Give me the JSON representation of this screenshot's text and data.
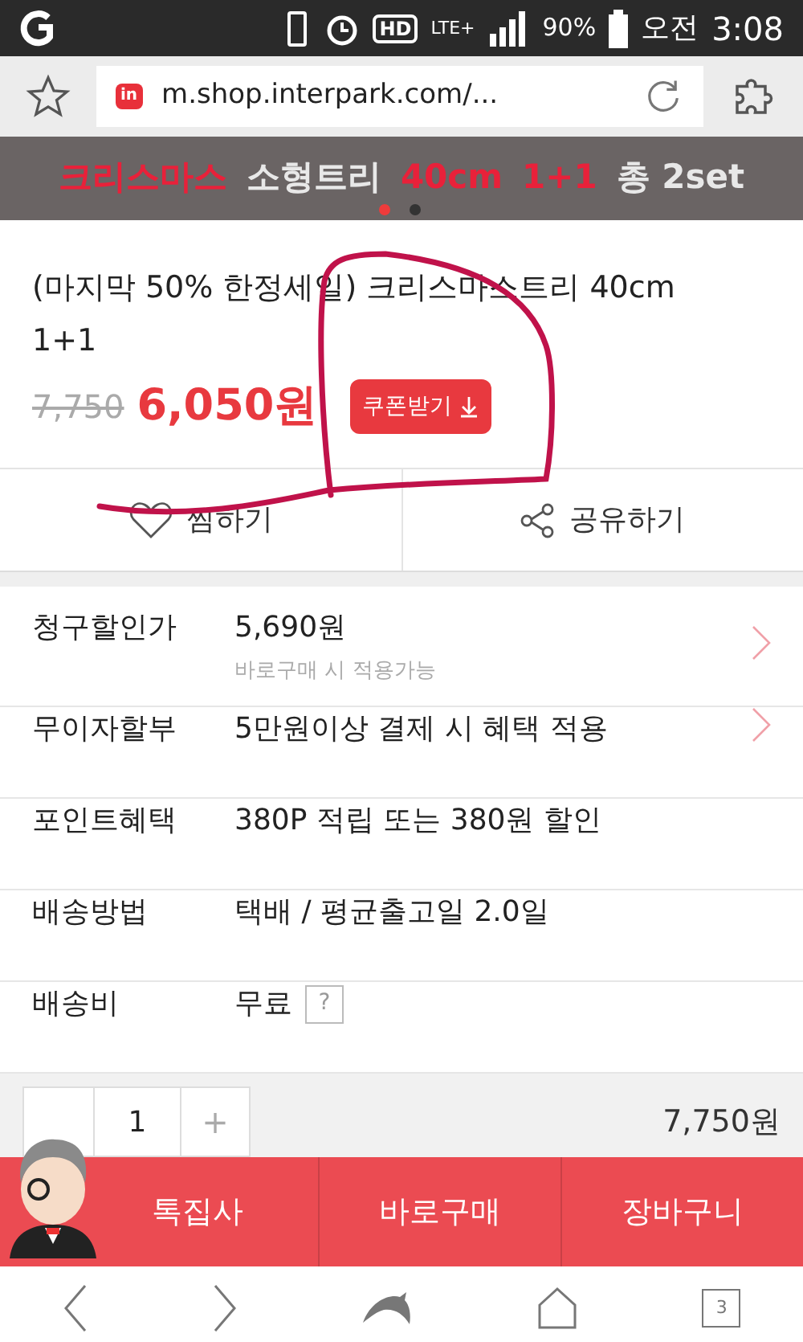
{
  "status_bar": {
    "hd": "HD",
    "network": "LTE+",
    "battery": "90%",
    "ampm": "오전",
    "time": "3:08"
  },
  "browser": {
    "favicon": "in",
    "url": "m.shop.interpark.com/..."
  },
  "banner": {
    "segments": [
      {
        "text": "크리스마스",
        "kind": "accent"
      },
      {
        "text": "소형트리",
        "kind": "plain"
      },
      {
        "text": "40cm",
        "kind": "accent"
      },
      {
        "text": "1+1",
        "kind": "accent"
      },
      {
        "text": "총 2set",
        "kind": "plain"
      }
    ],
    "dots": [
      {
        "selected": true
      },
      {
        "selected": false
      }
    ]
  },
  "product": {
    "title": "(마지막 50% 한정세일) 크리스마스트리 40cm 1+1",
    "original_price": "7,750",
    "price": "6,050원",
    "coupon_button": "쿠폰받기"
  },
  "actions": [
    {
      "label": "찜하기",
      "kind": "heart"
    },
    {
      "label": "공유하기",
      "kind": "share"
    }
  ],
  "info_rows": [
    {
      "label": "청구할인가",
      "value": "5,690원",
      "note": "바로구매 시 적용가능",
      "arrow": true
    },
    {
      "label": "무이자할부",
      "value": "5만원이상 결제 시 혜택 적용",
      "arrow": true
    },
    {
      "label": "포인트혜택",
      "value": "380P 적립 또는 380원 할인",
      "arrow": false
    },
    {
      "label": "배송방법",
      "value": "택배 / 평균출고일 2.0일",
      "arrow": false
    },
    {
      "label": "배송비",
      "value": "무료",
      "help": "?",
      "arrow": false
    }
  ],
  "quantity": {
    "value": "1",
    "plus": "+"
  },
  "total": "7,750원",
  "bottom_bar": [
    "톡집사",
    "바로구매",
    "장바구니"
  ],
  "nav": {
    "tabs_count": "3"
  }
}
